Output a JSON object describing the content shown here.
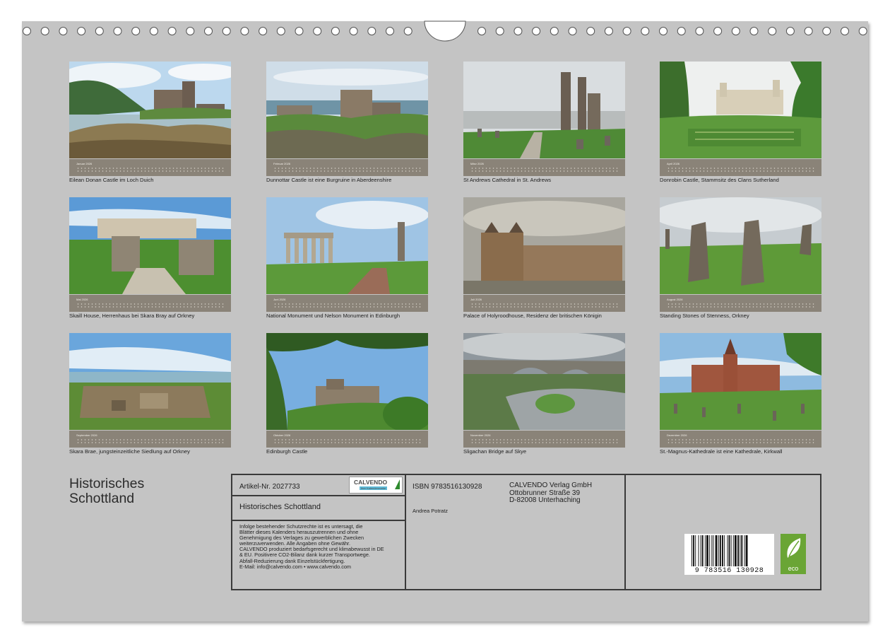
{
  "cover": {
    "title_line1": "Historisches",
    "title_line2": "Schottland"
  },
  "months": [
    {
      "month": "Januar 2026",
      "caption": "Eilean Donan Castle im Loch Duich"
    },
    {
      "month": "Februar 2026",
      "caption": "Dunnottar Castle ist eine Burgruine in Aberdeenshire"
    },
    {
      "month": "März 2026",
      "caption": "St Andrews Cathedral in St. Andrews"
    },
    {
      "month": "April 2026",
      "caption": "Donrobin Castle, Stammsitz des Clans Sutherland"
    },
    {
      "month": "Mai 2026",
      "caption": "Skaill House, Herrenhaus bei Skara Bray auf Orkney"
    },
    {
      "month": "Juni 2026",
      "caption": "National Monument und Nelson Monument in Edinburgh"
    },
    {
      "month": "Juli 2026",
      "caption": "Palace of Holyroodhouse, Residenz der britischen Königin"
    },
    {
      "month": "August 2026",
      "caption": "Standing Stones of Stenness, Orkney"
    },
    {
      "month": "September 2026",
      "caption": "Skara Brae, jungsteinzeitliche Siedlung auf Orkney"
    },
    {
      "month": "Oktober 2026",
      "caption": "Edinburgh Castle"
    },
    {
      "month": "November 2026",
      "caption": "Sligachan Bridge auf Skye"
    },
    {
      "month": "Dezember 2026",
      "caption": "St.-Magnus-Kathedrale ist eine Kathedrale, Kirkwall"
    }
  ],
  "info": {
    "article_number": "Artikel-Nr. 2027733",
    "calendar_title": "Historisches Schottland",
    "logo_text": "CALVENDO",
    "logo_subtext": "Ihre Kalendermarke",
    "isbn": "ISBN 9783516130928",
    "author": "Andrea Potratz",
    "publisher_name": "CALVENDO Verlag GmbH",
    "publisher_street": "Ottobrunner Straße 39",
    "publisher_city": "D-82008 Unterhaching",
    "disclaimer": [
      "Infolge bestehender Schutzrechte ist es untersagt, die",
      "Blätter dieses Kalenders herauszutrennen und ohne",
      "Genehmigung des Verlages zu gewerblichen Zwecken",
      "weiterzuverwenden. Alle Angaben ohne Gewähr.",
      "CALVENDO produziert bedarfsgerecht und klimabewusst in DE",
      "& EU. Positivere CO2-Bilanz dank kurzer Transportwege.",
      "Abfall-Reduzierung dank Einzelstückfertigung.",
      "E-Mail: info@calvendo.com • www.calvendo.com"
    ],
    "barcode_digits": "9 783516 130928",
    "eco_label": "eco"
  },
  "colors": {
    "sheet": "#c4c4c4",
    "strip": "#8a8378",
    "eco_green": "#6aa535"
  }
}
